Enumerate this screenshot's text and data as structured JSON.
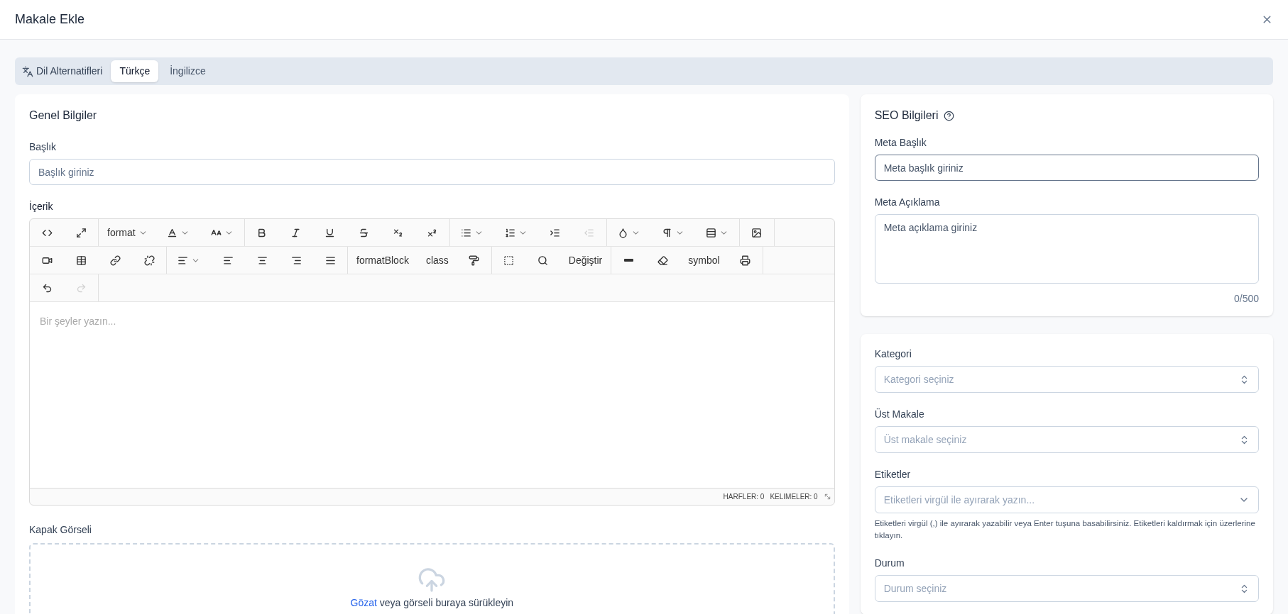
{
  "modal": {
    "title": "Makale Ekle"
  },
  "language_tabs": {
    "label": "Dil Alternatifleri",
    "tabs": [
      {
        "label": "Türkçe",
        "selected": true
      },
      {
        "label": "İngilizce",
        "selected": false
      }
    ]
  },
  "general": {
    "title": "Genel Bilgiler",
    "title_field": {
      "label": "Başlık",
      "placeholder": "Başlık giriniz"
    },
    "content": {
      "label": "İçerik",
      "toolbar": [
        [
          [
            {
              "kind": "icon",
              "dropdown": false,
              "disabled": false
            },
            {
              "kind": "icon",
              "dropdown": false,
              "disabled": false
            }
          ],
          [
            {
              "kind": "text",
              "label": "format",
              "dropdown": true,
              "disabled": false
            },
            {
              "kind": "icon",
              "dropdown": true,
              "disabled": false
            },
            {
              "kind": "icon",
              "dropdown": true,
              "disabled": false
            }
          ],
          [
            {
              "kind": "icon",
              "dropdown": false,
              "disabled": false
            },
            {
              "kind": "icon",
              "dropdown": false,
              "disabled": false
            },
            {
              "kind": "icon",
              "dropdown": false,
              "disabled": false
            },
            {
              "kind": "icon",
              "dropdown": false,
              "disabled": false
            },
            {
              "kind": "icon",
              "dropdown": false,
              "disabled": false
            },
            {
              "kind": "icon",
              "dropdown": false,
              "disabled": false
            }
          ],
          [
            {
              "kind": "icon",
              "dropdown": true,
              "disabled": false
            },
            {
              "kind": "icon",
              "dropdown": true,
              "disabled": false
            },
            {
              "kind": "icon",
              "dropdown": false,
              "disabled": false
            },
            {
              "kind": "icon",
              "dropdown": false,
              "disabled": true
            }
          ],
          [
            {
              "kind": "icon",
              "dropdown": true,
              "disabled": false
            },
            {
              "kind": "icon",
              "dropdown": true,
              "disabled": false
            },
            {
              "kind": "icon",
              "dropdown": true,
              "disabled": false
            }
          ],
          [
            {
              "kind": "icon",
              "dropdown": false,
              "disabled": false
            }
          ]
        ],
        [
          [
            {
              "kind": "icon",
              "dropdown": false,
              "disabled": false
            },
            {
              "kind": "icon",
              "dropdown": false,
              "disabled": false
            },
            {
              "kind": "icon",
              "dropdown": false,
              "disabled": false
            },
            {
              "kind": "icon",
              "dropdown": false,
              "disabled": false
            }
          ],
          [
            {
              "kind": "icon",
              "dropdown": true,
              "disabled": false
            },
            {
              "kind": "icon",
              "dropdown": false,
              "disabled": false
            },
            {
              "kind": "icon",
              "dropdown": false,
              "disabled": false
            },
            {
              "kind": "icon",
              "dropdown": false,
              "disabled": false
            },
            {
              "kind": "icon",
              "dropdown": false,
              "disabled": false
            }
          ],
          [
            {
              "kind": "text",
              "label": "formatBlock",
              "dropdown": false,
              "disabled": false
            },
            {
              "kind": "text",
              "label": "class",
              "dropdown": false,
              "disabled": false
            },
            {
              "kind": "icon",
              "dropdown": false,
              "disabled": false
            }
          ],
          [
            {
              "kind": "icon",
              "dropdown": false,
              "disabled": false
            },
            {
              "kind": "icon",
              "dropdown": false,
              "disabled": false
            },
            {
              "kind": "text",
              "label": "Değiştir",
              "dropdown": false,
              "disabled": false
            }
          ],
          [
            {
              "kind": "icon",
              "dropdown": false,
              "disabled": false
            },
            {
              "kind": "icon",
              "dropdown": false,
              "disabled": false
            },
            {
              "kind": "text",
              "label": "symbol",
              "dropdown": false,
              "disabled": false
            },
            {
              "kind": "icon",
              "dropdown": false,
              "disabled": false
            }
          ]
        ],
        [
          [
            {
              "kind": "icon",
              "dropdown": false,
              "disabled": false
            },
            {
              "kind": "icon",
              "dropdown": false,
              "disabled": true
            }
          ]
        ]
      ],
      "placeholder": "Bir şeyler yazın...",
      "status": [
        "HARFLER: 0",
        "KELIMELER: 0"
      ]
    },
    "cover": {
      "label": "Kapak Görseli",
      "link": "Gözat",
      "text": "veya görseli buraya sürükleyin"
    }
  },
  "seo": {
    "title": "SEO Bilgileri",
    "meta_title": {
      "label": "Meta Başlık",
      "placeholder": "Meta başlık giriniz",
      "focused": true
    },
    "meta_description": {
      "label": "Meta Açıklama",
      "placeholder": "Meta açıklama giriniz",
      "counter": "0/500"
    }
  },
  "details": {
    "fields": [
      {
        "kind": "select",
        "label": "Kategori",
        "placeholder": "Kategori seçiniz"
      },
      {
        "kind": "select",
        "label": "Üst Makale",
        "placeholder": "Üst makale seçiniz"
      },
      {
        "kind": "tags",
        "label": "Etiketler",
        "placeholder": "Etiketleri virgül ile ayırarak yazın...",
        "help": "Etiketleri virgül (,) ile ayırarak yazabilir veya Enter tuşuna basabilirsiniz. Etiketleri kaldırmak için üzerlerine tıklayın."
      },
      {
        "kind": "select",
        "label": "Durum",
        "placeholder": "Durum seçiniz"
      }
    ]
  }
}
